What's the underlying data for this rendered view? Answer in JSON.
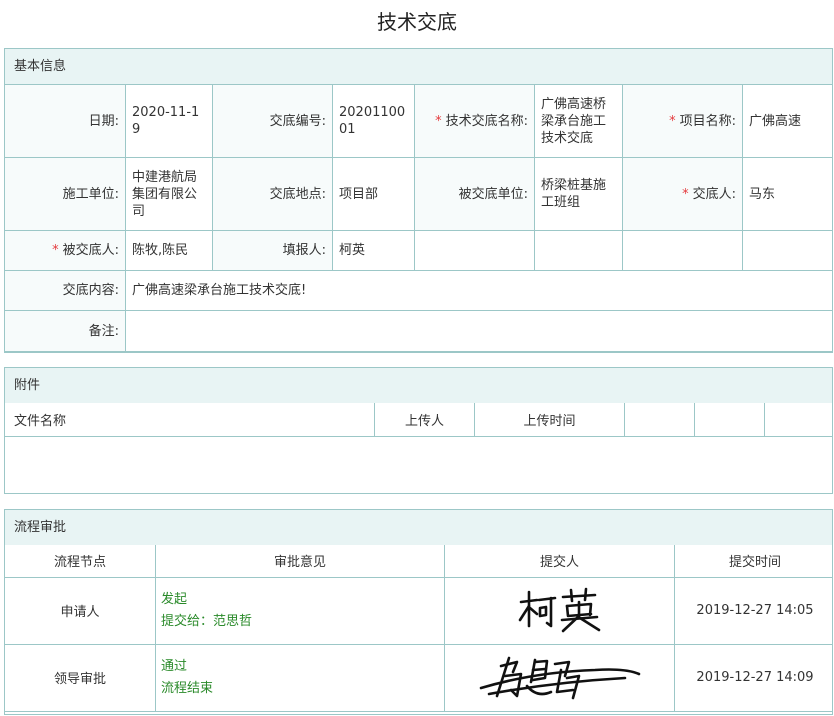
{
  "page": {
    "title": "技术交底"
  },
  "basic": {
    "header": "基本信息",
    "rows": [
      [
        {
          "label": "日期:",
          "value": "2020-11-19",
          "required": false
        },
        {
          "label": "交底编号:",
          "value": "2020110001",
          "required": false
        },
        {
          "label": "技术交底名称:",
          "value": "广佛高速桥梁承台施工技术交底",
          "required": true
        },
        {
          "label": "项目名称:",
          "value": "广佛高速",
          "required": true
        }
      ],
      [
        {
          "label": "施工单位:",
          "value": "中建港航局集团有限公司",
          "required": false
        },
        {
          "label": "交底地点:",
          "value": "项目部",
          "required": false
        },
        {
          "label": "被交底单位:",
          "value": "桥梁桩基施工班组",
          "required": false
        },
        {
          "label": "交底人:",
          "value": "马东",
          "required": true
        }
      ],
      [
        {
          "label": "被交底人:",
          "value": "陈牧,陈民",
          "required": true
        },
        {
          "label": "填报人:",
          "value": "柯英",
          "required": false
        }
      ]
    ],
    "content": {
      "label": "交底内容:",
      "value": "广佛高速梁承台施工技术交底!"
    },
    "remark": {
      "label": "备注:",
      "value": ""
    }
  },
  "attachments": {
    "header": "附件",
    "columns": [
      "文件名称",
      "上传人",
      "上传时间",
      "",
      ""
    ]
  },
  "flow": {
    "header": "流程审批",
    "columns": [
      "流程节点",
      "审批意见",
      "提交人",
      "提交时间"
    ],
    "rows": [
      {
        "node": "申请人",
        "opinion": "发起",
        "opinion2": "提交给：范思哲",
        "signature": "柯英",
        "time": "2019-12-27 14:05"
      },
      {
        "node": "领导审批",
        "opinion": "通过",
        "opinion2": "流程结束",
        "signature": "范思哲",
        "time": "2019-12-27 14:09"
      }
    ]
  },
  "colors": {
    "border": "#9cc7c7",
    "header_bg": "#e8f4f4",
    "label_bg": "#f7fbfb",
    "required": "#e4393c",
    "opinion": "#2a8a2a"
  }
}
